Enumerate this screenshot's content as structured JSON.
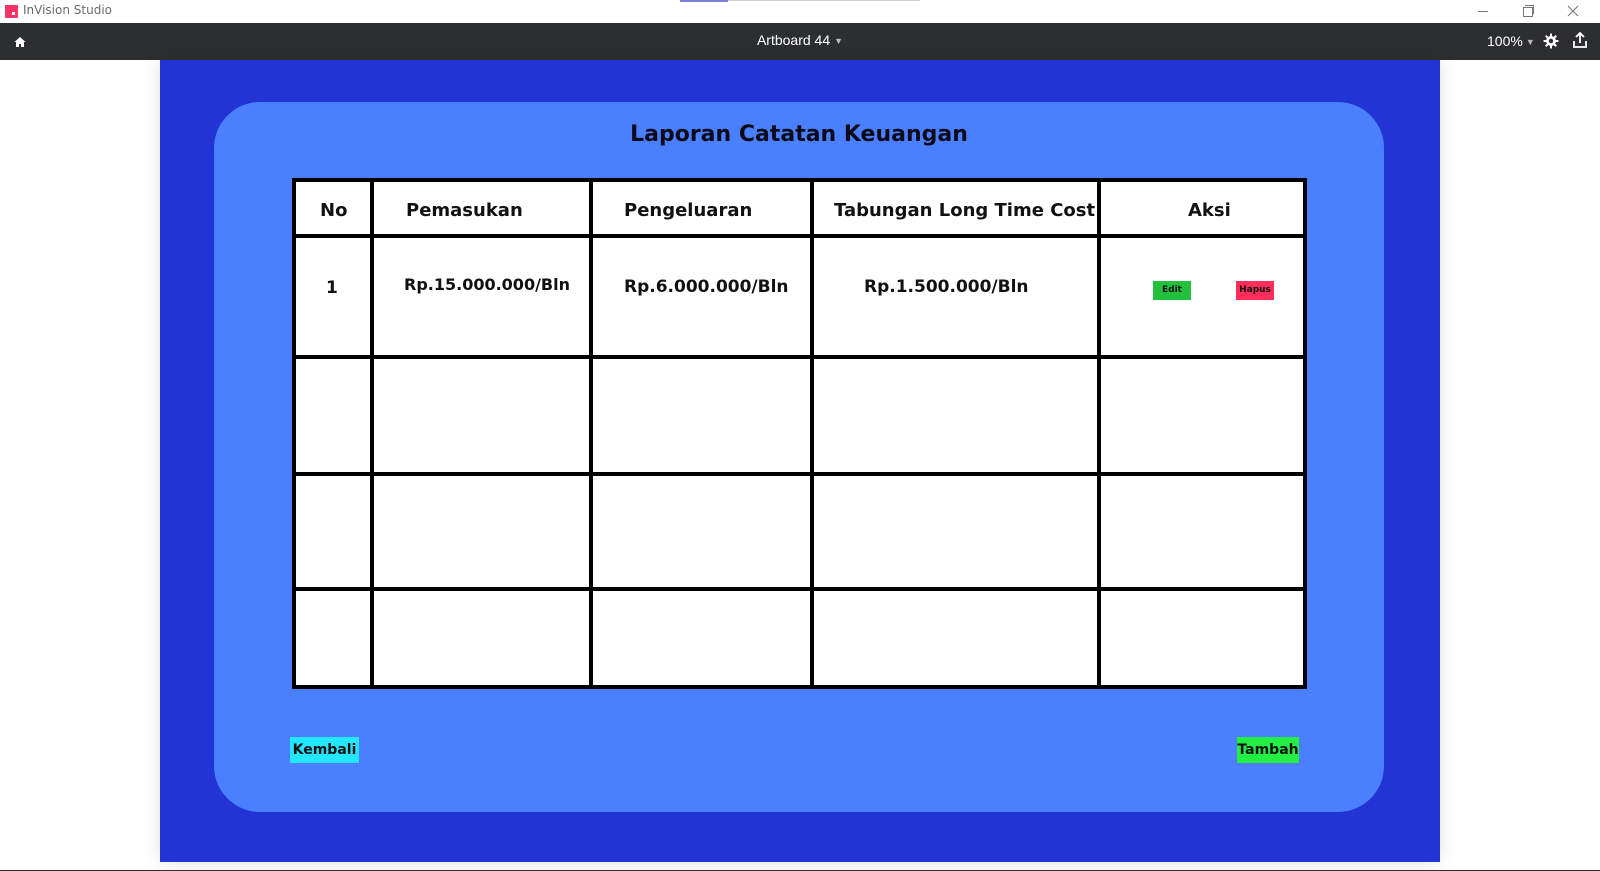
{
  "window": {
    "app_name": "InVision Studio",
    "logo_color": "#ff3366"
  },
  "toolbar": {
    "artboard_name": "Artboard 44",
    "zoom": "100%",
    "background": "#2d2e30"
  },
  "artboard": {
    "background": "#2334d4",
    "panel_color": "#4a80ff",
    "title": "Laporan Catatan Keuangan",
    "table": {
      "headers": [
        "No",
        "Pemasukan",
        "Pengeluaran",
        "Tabungan Long Time Cost",
        "Aksi"
      ],
      "rows": [
        {
          "no": "1",
          "pemasukan": "Rp.15.000.000/Bln",
          "pengeluaran": "Rp.6.000.000/Bln",
          "tabungan": "Rp.1.500.000/Bln",
          "actions": {
            "edit": "Edit",
            "hapus": "Hapus"
          }
        }
      ],
      "empty_rows": 3
    },
    "buttons": {
      "kembali": "Kembali",
      "tambah": "Tambah"
    },
    "colors": {
      "edit": "#22c03c",
      "hapus": "#ff2d5a",
      "kembali": "#23e6ff",
      "tambah": "#22ee44"
    }
  }
}
